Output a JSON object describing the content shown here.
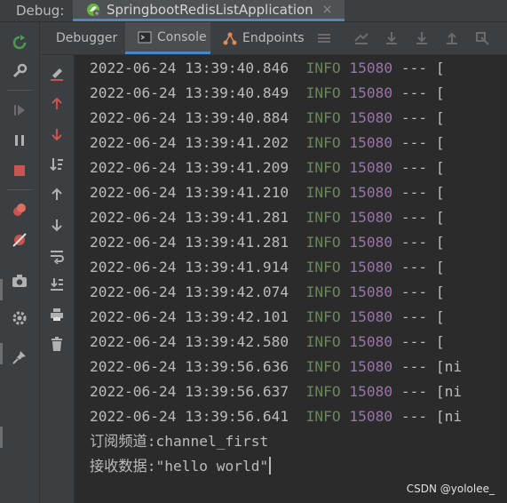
{
  "header": {
    "debug_label": "Debug:",
    "run_tab_title": "SpringbootRedisListApplication",
    "close_glyph": "×"
  },
  "tabs": [
    {
      "label": "Debugger",
      "icon": null
    },
    {
      "label": "Console",
      "icon": "console-icon"
    },
    {
      "label": "Endpoints",
      "icon": "endpoints-icon"
    }
  ],
  "log_lines": [
    {
      "ts": "2022-06-24 13:39:40.846",
      "level": "INFO",
      "pid": "15080",
      "rest": "--- ["
    },
    {
      "ts": "2022-06-24 13:39:40.849",
      "level": "INFO",
      "pid": "15080",
      "rest": "--- ["
    },
    {
      "ts": "2022-06-24 13:39:40.884",
      "level": "INFO",
      "pid": "15080",
      "rest": "--- ["
    },
    {
      "ts": "2022-06-24 13:39:41.202",
      "level": "INFO",
      "pid": "15080",
      "rest": "--- ["
    },
    {
      "ts": "2022-06-24 13:39:41.209",
      "level": "INFO",
      "pid": "15080",
      "rest": "--- ["
    },
    {
      "ts": "2022-06-24 13:39:41.210",
      "level": "INFO",
      "pid": "15080",
      "rest": "--- ["
    },
    {
      "ts": "2022-06-24 13:39:41.281",
      "level": "INFO",
      "pid": "15080",
      "rest": "--- ["
    },
    {
      "ts": "2022-06-24 13:39:41.281",
      "level": "INFO",
      "pid": "15080",
      "rest": "--- ["
    },
    {
      "ts": "2022-06-24 13:39:41.914",
      "level": "INFO",
      "pid": "15080",
      "rest": "--- ["
    },
    {
      "ts": "2022-06-24 13:39:42.074",
      "level": "INFO",
      "pid": "15080",
      "rest": "--- ["
    },
    {
      "ts": "2022-06-24 13:39:42.101",
      "level": "INFO",
      "pid": "15080",
      "rest": "--- ["
    },
    {
      "ts": "2022-06-24 13:39:42.580",
      "level": "INFO",
      "pid": "15080",
      "rest": "--- ["
    },
    {
      "ts": "2022-06-24 13:39:56.636",
      "level": "INFO",
      "pid": "15080",
      "rest": "--- [ni"
    },
    {
      "ts": "2022-06-24 13:39:56.637",
      "level": "INFO",
      "pid": "15080",
      "rest": "--- [ni"
    },
    {
      "ts": "2022-06-24 13:39:56.641",
      "level": "INFO",
      "pid": "15080",
      "rest": "--- [ni"
    }
  ],
  "output_lines": [
    "订阅频道:channel_first",
    "接收数据:\"hello world\""
  ],
  "watermark": "CSDN @yololee_",
  "colors": {
    "background": "#2b2b2b",
    "panel": "#3c3f41",
    "info": "#6a8759",
    "pid": "#9876aa",
    "accent": "#4a88c7",
    "rerun": "#499c54",
    "stop": "#c75450"
  }
}
